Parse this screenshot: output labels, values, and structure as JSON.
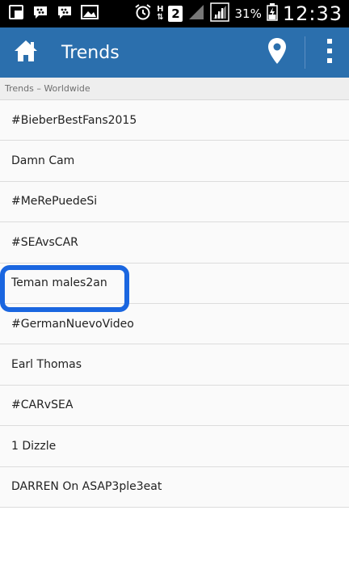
{
  "status_bar": {
    "network_type": "H",
    "sim_slot": "2",
    "battery_percent": "31%",
    "time": "12:33",
    "icons": [
      "screenshot-icon",
      "bbm-icon",
      "bbm-icon",
      "gallery-icon",
      "alarm-icon",
      "network-h-icon",
      "sim-2-icon",
      "signal-icon",
      "signal-icon",
      "battery-icon"
    ]
  },
  "action_bar": {
    "title": "Trends",
    "background": "#2b6fad",
    "icons": [
      "home-icon",
      "location-pin-icon",
      "overflow-menu-icon"
    ]
  },
  "section_header": {
    "label": "Trends – Worldwide"
  },
  "trends": [
    {
      "label": "#BieberBestFans2015"
    },
    {
      "label": "Damn Cam"
    },
    {
      "label": "#MeRePuedeSi"
    },
    {
      "label": "#SEAvsCAR"
    },
    {
      "label": "Teman males2an"
    },
    {
      "label": "#GermanNuevoVideo"
    },
    {
      "label": "Earl Thomas"
    },
    {
      "label": "#CARvSEA"
    },
    {
      "label": "1 Dizzle"
    },
    {
      "label": "DARREN On ASAP3ple3eat"
    }
  ],
  "annotation": {
    "highlight_color": "#1a66e0",
    "highlighted_item": "Teman males2an"
  }
}
